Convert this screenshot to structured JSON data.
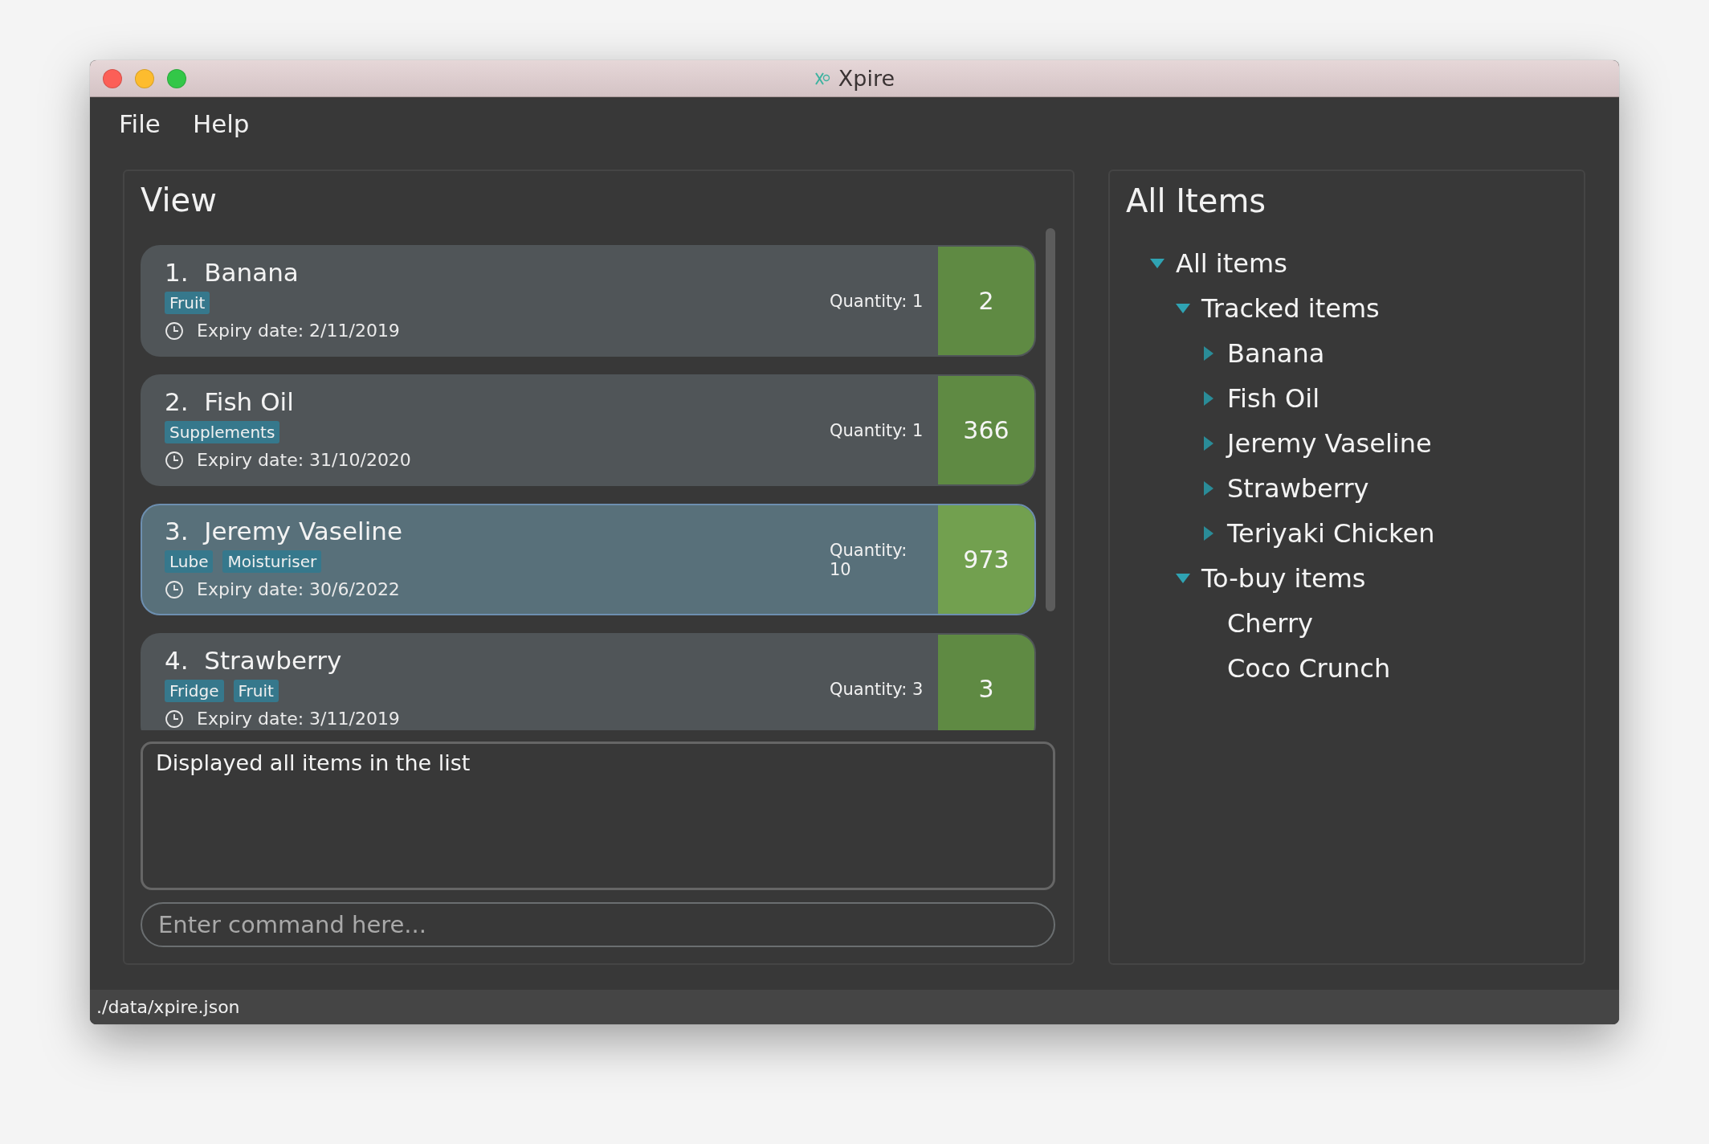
{
  "window": {
    "title": "Xpire"
  },
  "menu": [
    "File",
    "Help"
  ],
  "view": {
    "title": "View",
    "items": [
      {
        "index": "1.",
        "name": "Banana",
        "tags": [
          "Fruit"
        ],
        "expiry": "Expiry date: 2/11/2019",
        "quantity": "Quantity: 1",
        "days": "2",
        "selected": false
      },
      {
        "index": "2.",
        "name": "Fish Oil",
        "tags": [
          "Supplements"
        ],
        "expiry": "Expiry date: 31/10/2020",
        "quantity": "Quantity: 1",
        "days": "366",
        "selected": false
      },
      {
        "index": "3.",
        "name": "Jeremy Vaseline",
        "tags": [
          "Lube",
          "Moisturiser"
        ],
        "expiry": "Expiry date: 30/6/2022",
        "quantity": "Quantity: 10",
        "days": "973",
        "selected": true
      },
      {
        "index": "4.",
        "name": "Strawberry",
        "tags": [
          "Fridge",
          "Fruit"
        ],
        "expiry": "Expiry date: 3/11/2019",
        "quantity": "Quantity: 3",
        "days": "3",
        "selected": false
      }
    ],
    "result": "Displayed all items in the list",
    "command": {
      "placeholder": "Enter command here..."
    }
  },
  "all_items": {
    "title": "All Items",
    "tree": [
      {
        "label": "All items",
        "expanded": true,
        "children": [
          {
            "label": "Tracked items",
            "expanded": true,
            "children": [
              {
                "label": "Banana",
                "expanded": false
              },
              {
                "label": "Fish Oil",
                "expanded": false
              },
              {
                "label": "Jeremy Vaseline",
                "expanded": false
              },
              {
                "label": "Strawberry",
                "expanded": false
              },
              {
                "label": "Teriyaki Chicken",
                "expanded": false
              }
            ]
          },
          {
            "label": "To-buy items",
            "expanded": true,
            "children": [
              {
                "label": "Cherry"
              },
              {
                "label": "Coco Crunch"
              }
            ]
          }
        ]
      }
    ]
  },
  "status_bar": "./data/xpire.json"
}
